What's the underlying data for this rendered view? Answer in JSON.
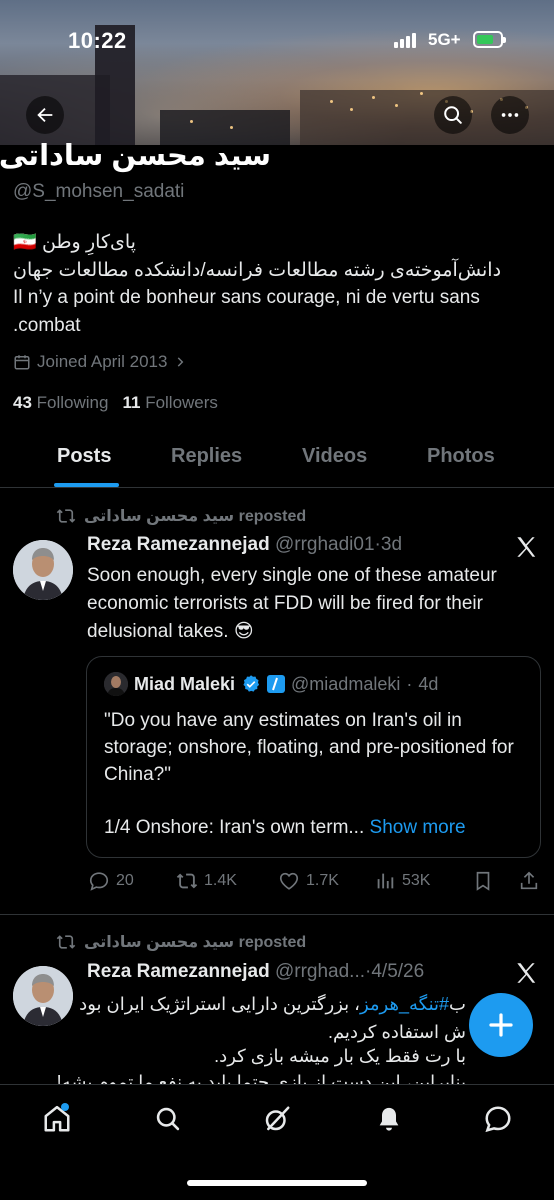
{
  "status_bar": {
    "time": "10:22",
    "network": "5G+"
  },
  "profile": {
    "display_name": "سید محسن ساداتی",
    "handle": "@S_mohsen_sadati",
    "bio_line1": "پای‌کارِ وطن",
    "bio_flag": "🇮🇷",
    "bio_line2": "دانش‌آموخته‌ی رشته مطالعات فرانسه/دانشکده مطالعات جهان",
    "bio_line3": "Il n’y a point de bonheur sans courage, ni de vertu sans",
    "bio_line4": ".combat",
    "joined": "Joined April 2013",
    "following_count": "43",
    "following_label": "Following",
    "followers_count": "11",
    "followers_label": "Followers"
  },
  "tabs": [
    {
      "label": "Posts"
    },
    {
      "label": "Replies"
    },
    {
      "label": "Videos"
    },
    {
      "label": "Photos"
    }
  ],
  "post1": {
    "repost_label": "سید محسن ساداتی reposted",
    "author_name": "Reza Ramezannejad",
    "author_handle": "@rrghadi01",
    "time": "3d",
    "separator": "·",
    "text_line1": "Soon enough, every single one of these amateur",
    "text_line2": "economic terrorists at FDD will be fired for their",
    "text_line3": "delusional takes.",
    "emoji": "😎",
    "quote": {
      "author_name": "Miad Maleki",
      "author_handle": "@miadmaleki",
      "time": "4d",
      "text": "\"Do you have any estimates on Iran's oil in storage; onshore, floating, and pre-positioned for China?\"",
      "preview": "1/4 Onshore: Iran's own term...",
      "show_more": "Show more"
    },
    "replies": "20",
    "reposts": "1.4K",
    "likes": "1.7K",
    "views": "53K"
  },
  "post2": {
    "repost_label": "سید محسن ساداتی reposted",
    "author_name": "Reza Ramezannejad",
    "author_handle": "@rrghad...",
    "time": "4/5/26",
    "separator": "·",
    "line1_prefix": "ب",
    "line1_hashtag": "#تنگه_هرمز",
    "line1_rest": "، بزرگترین دارایی استراتژیک ایران بود",
    "line2": "ش استفاده کردیم.",
    "line3": "با    رت فقط یک بار میشه بازی کرد.",
    "line4": "بنابراین، این دست از بازی حتما باید به نفع ما تموم بشه!"
  },
  "colors": {
    "accent": "#1d9bf0",
    "muted": "#71767b",
    "text": "#e7e9ea",
    "bg": "#000000"
  }
}
